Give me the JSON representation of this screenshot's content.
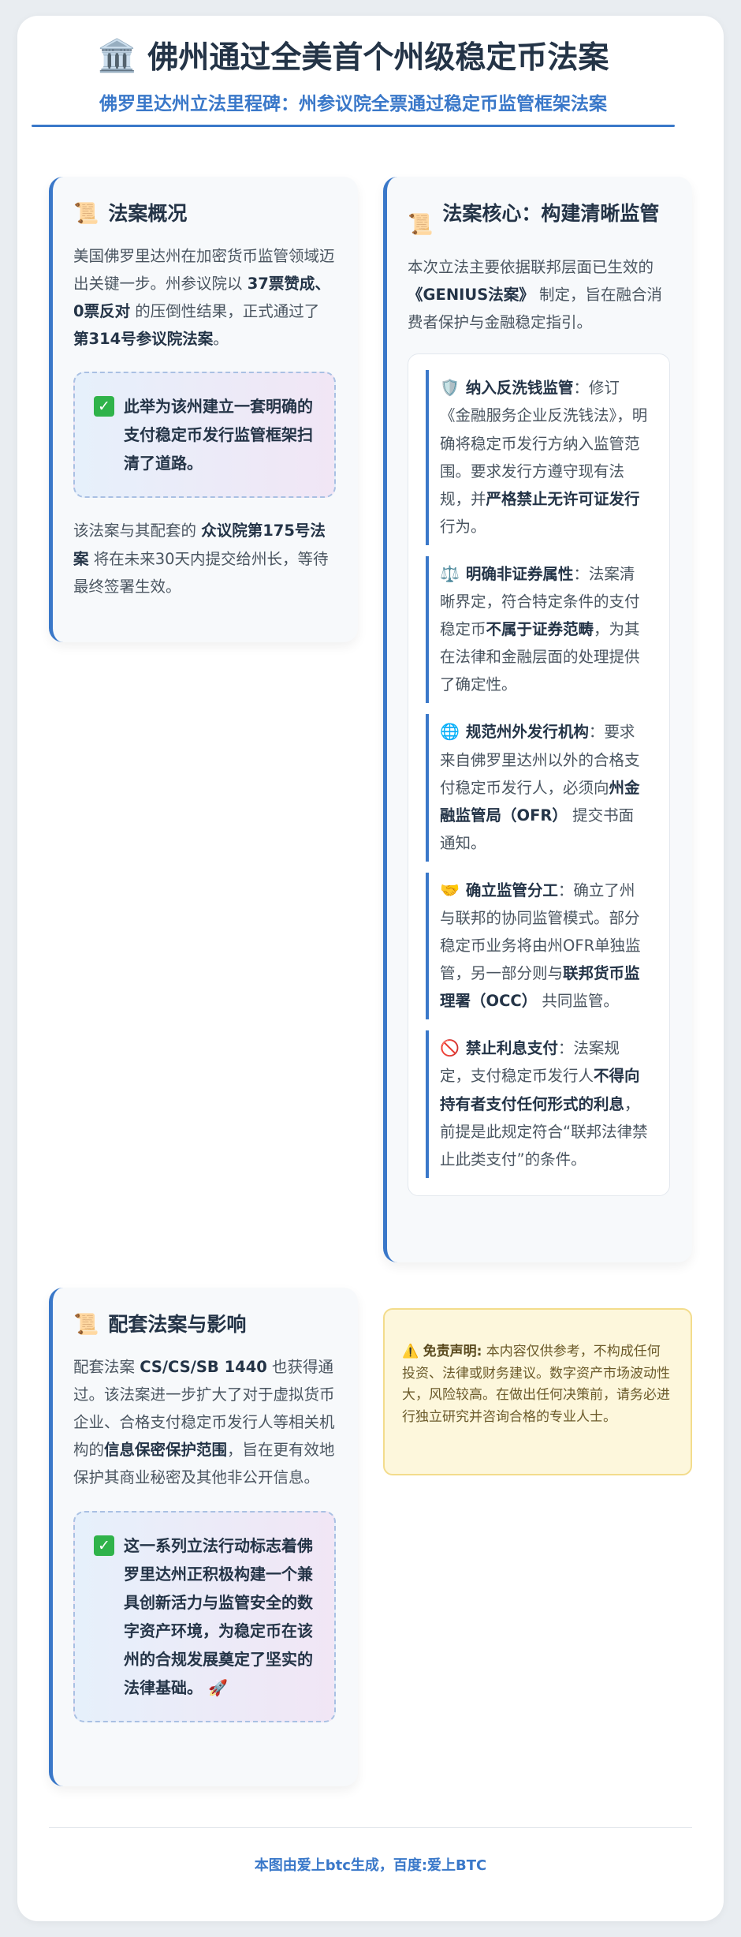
{
  "header": {
    "title_icon": "🏛️",
    "title": "佛州通过全美首个州级稳定币法案",
    "subtitle": "佛罗里达州立法里程碑：州参议院全票通过稳定币监管框架法案"
  },
  "overview": {
    "icon": "📜",
    "title": "法案概况",
    "p1": {
      "t1": "美国佛罗里达州在加密货币监管领域迈出关键一步。州参议院以 ",
      "b1": "37票赞成、0票反对",
      "t2": " 的压倒性结果，正式通过了 ",
      "b2": "第314号参议院法案",
      "t3": "。"
    },
    "callout": "此举为该州建立一套明确的支付稳定币发行监管框架扫清了道路。",
    "p2": {
      "t1": "该法案与其配套的 ",
      "b1": "众议院第175号法案",
      "t2": " 将在未来30天内提交给州长，等待最终签署生效。"
    }
  },
  "core": {
    "icon": "📜",
    "title": "法案核心：构建清晰监管",
    "intro": {
      "t1": "本次立法主要依据联邦层面已生效的 ",
      "b1": "《GENIUS法案》",
      "t2": " 制定，旨在融合消费者保护与金融稳定指引。"
    },
    "items": [
      {
        "icon": "🛡️",
        "name": "纳入反洗钱监管",
        "t1": "：修订《金融服务企业反洗钱法》，明确将稳定币发行方纳入监管范围。要求发行方遵守现有法规，并",
        "b1": "严格禁止无许可证发行",
        "t2": "行为。"
      },
      {
        "icon": "⚖️",
        "name": "明确非证券属性",
        "t1": "：法案清晰界定，符合特定条件的支付稳定币",
        "b1": "不属于证券范畴",
        "t2": "，为其在法律和金融层面的处理提供了确定性。"
      },
      {
        "icon": "🌐",
        "name": "规范州外发行机构",
        "t1": "：要求来自佛罗里达州以外的合格支付稳定币发行人，必须向",
        "b1": "州金融监管局（OFR）",
        "t2": " 提交书面通知。"
      },
      {
        "icon": "🤝",
        "name": "确立监管分工",
        "t1": "：确立了州与联邦的协同监管模式。部分稳定币业务将由州OFR单独监管，另一部分则与",
        "b1": "联邦货币监理署（OCC）",
        "t2": " 共同监管。"
      },
      {
        "icon": "🚫",
        "name": "禁止利息支付",
        "t1": "：法案规定，支付稳定币发行人",
        "b1": "不得向持有者支付任何形式的利息",
        "t2": "，前提是此规定符合“联邦法律禁止此类支付”的条件。"
      }
    ]
  },
  "impact": {
    "icon": "📜",
    "title": "配套法案与影响",
    "p1": {
      "t1": "配套法案 ",
      "b1": "CS/CS/SB 1440",
      "t2": " 也获得通过。该法案进一步扩大了对于虚拟货币企业、合格支付稳定币发行人等相关机构的",
      "b2": "信息保密保护范围",
      "t3": "，旨在更有效地保护其商业秘密及其他非公开信息。"
    },
    "callout": "这一系列立法行动标志着佛罗里达州正积极构建一个兼具创新活力与监管安全的数字资产环境，为稳定币在该州的合规发展奠定了坚实的法律基础。",
    "callout_icon": "🚀"
  },
  "disclaimer": {
    "icon": "⚠️",
    "label": "免责声明:",
    "text": " 本内容仅供参考，不构成任何投资、法律或财务建议。数字资产市场波动性大，风险较高。在做出任何决策前，请务必进行独立研究并咨询合格的专业人士。"
  },
  "footer": {
    "text": "本图由爱上btc生成，百度:爱上BTC"
  },
  "colors": {
    "accent": "#3a78c9",
    "heading": "#243447",
    "check": "#2fb34a",
    "disclaimer_bg": "#fdf7dc"
  }
}
